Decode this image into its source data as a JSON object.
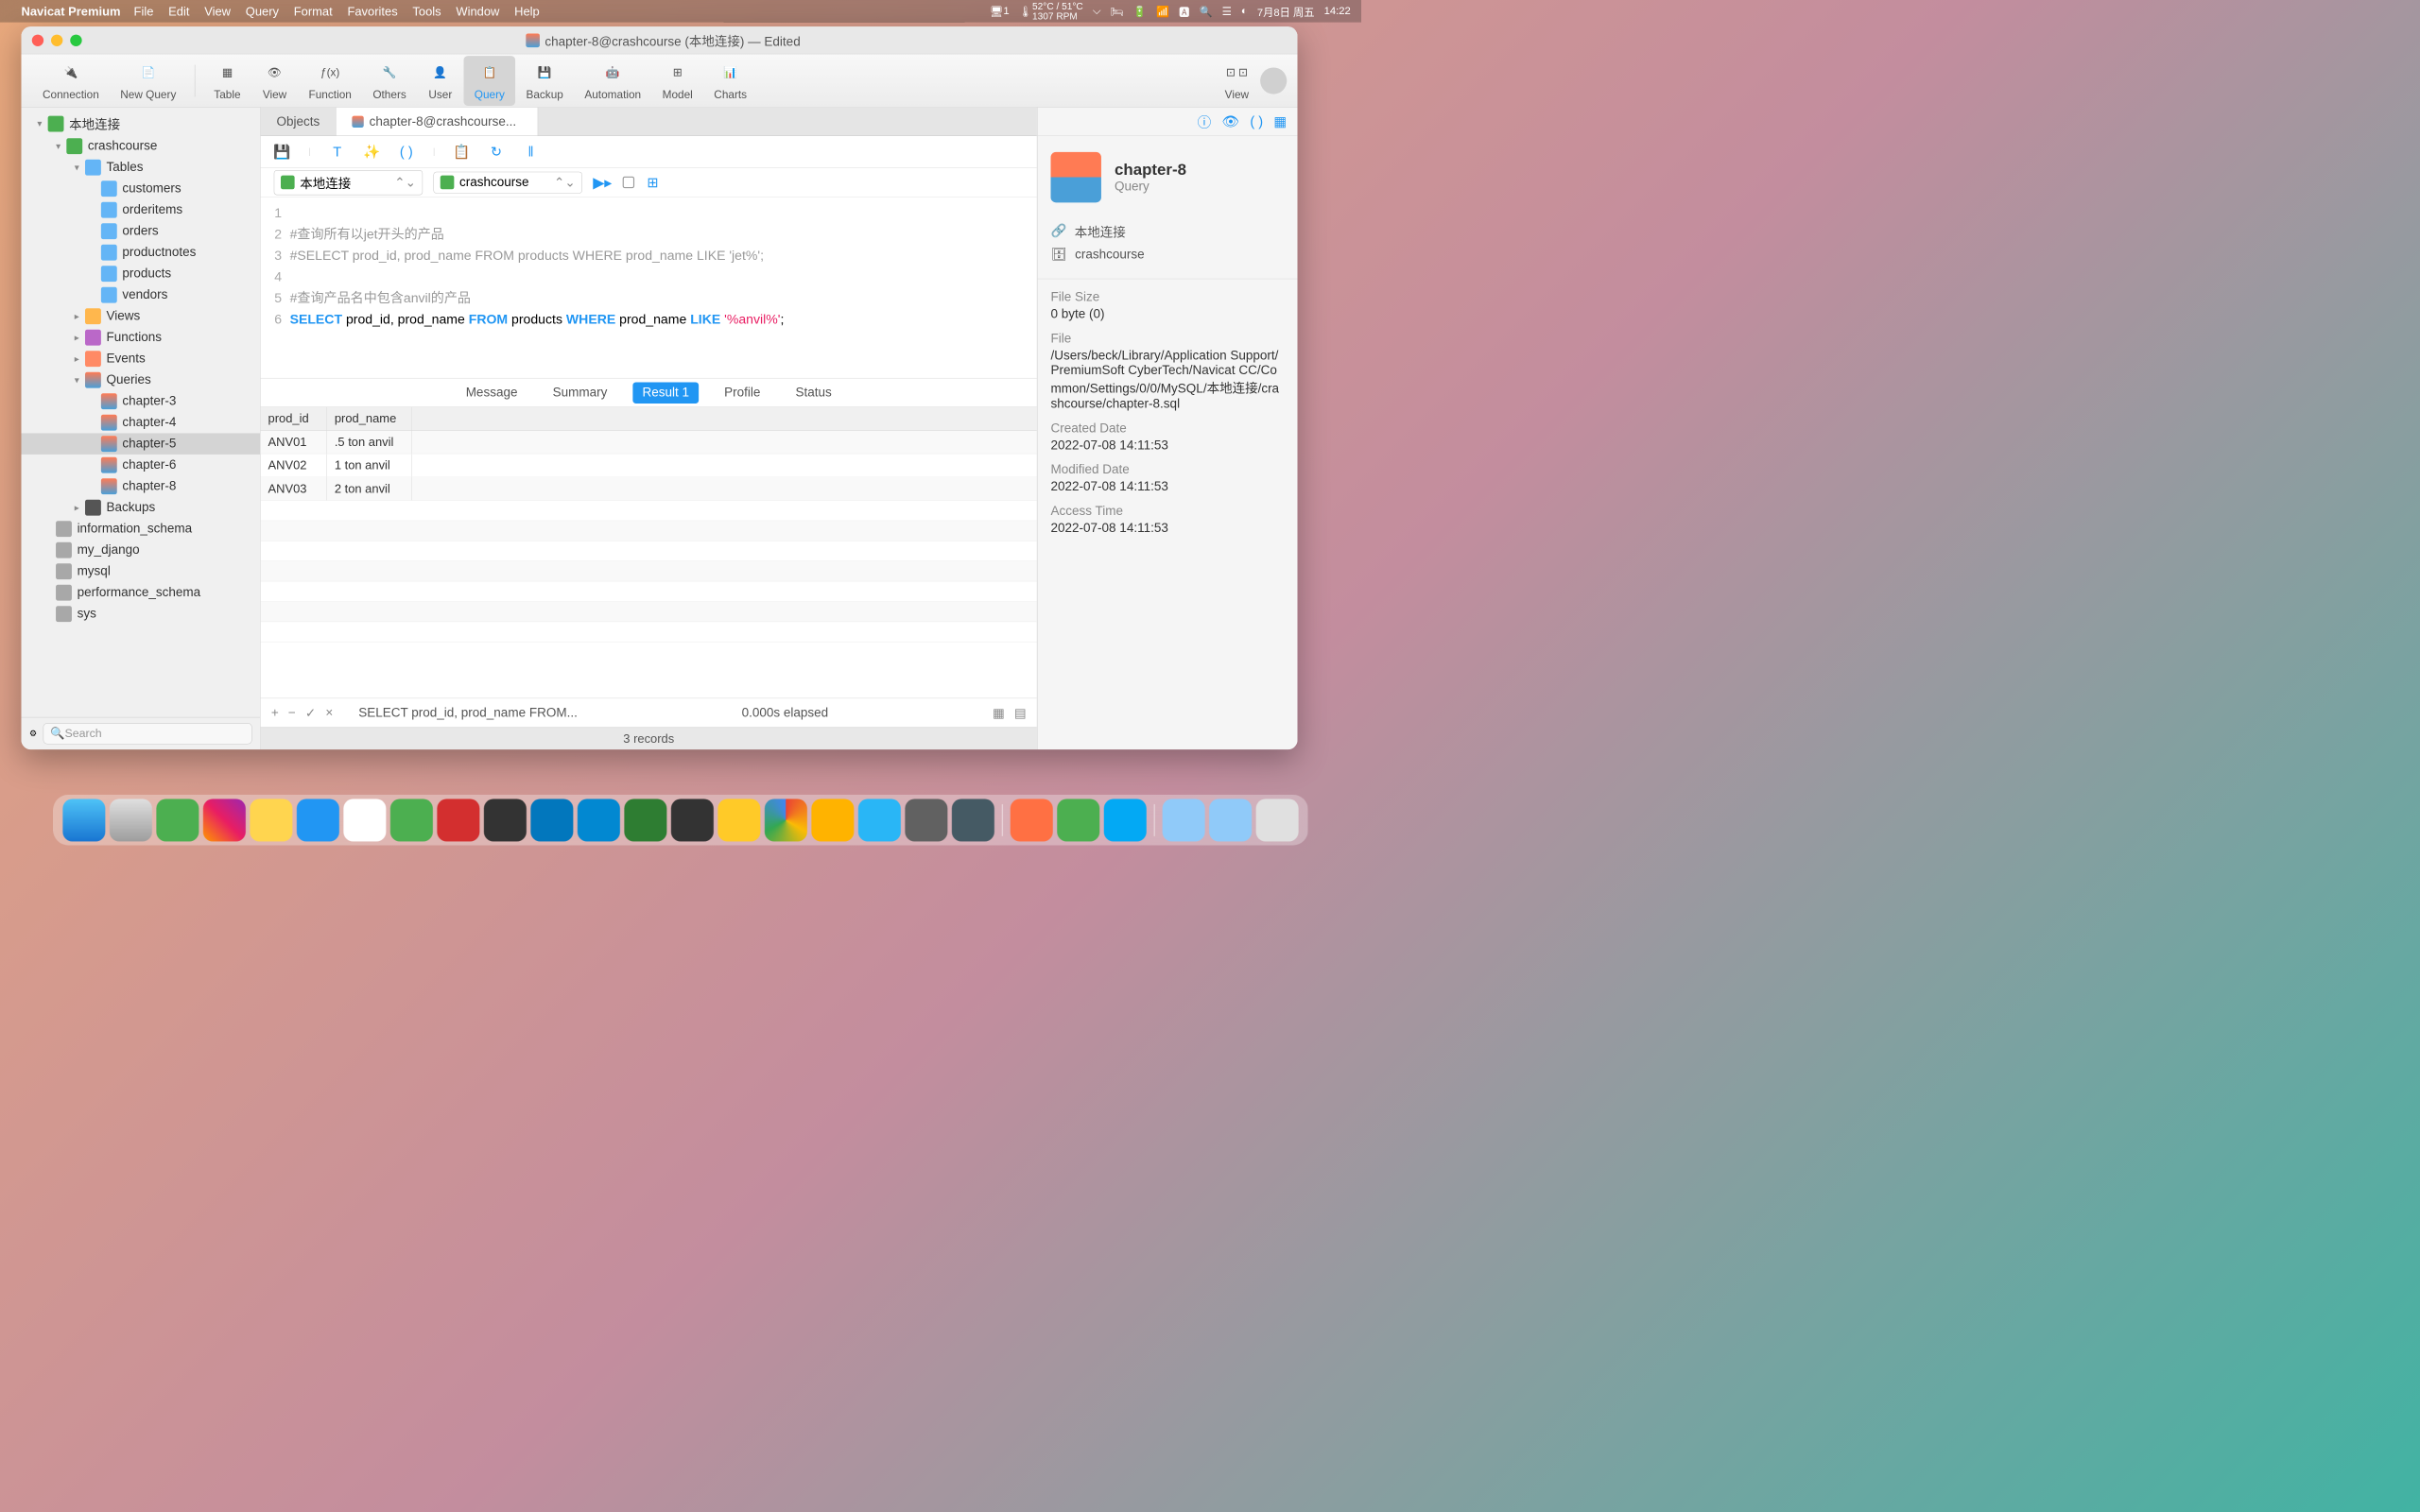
{
  "menubar": {
    "app_name": "Navicat Premium",
    "items": [
      "File",
      "Edit",
      "View",
      "Query",
      "Format",
      "Favorites",
      "Tools",
      "Window",
      "Help"
    ],
    "status": {
      "screen": "1",
      "temp_top": "52°C / 51°C",
      "temp_bot": "1307 RPM",
      "date": "7月8日 周五",
      "time": "14:22"
    }
  },
  "window": {
    "title": "chapter-8@crashcourse (本地连接) — Edited"
  },
  "toolbar": {
    "items": [
      "Connection",
      "New Query",
      "Table",
      "View",
      "Function",
      "Others",
      "User",
      "Query",
      "Backup",
      "Automation",
      "Model",
      "Charts"
    ],
    "view_label": "View"
  },
  "sidebar": {
    "conn": "本地连接",
    "db": "crashcourse",
    "tables_label": "Tables",
    "tables": [
      "customers",
      "orderitems",
      "orders",
      "productnotes",
      "products",
      "vendors"
    ],
    "views_label": "Views",
    "functions_label": "Functions",
    "events_label": "Events",
    "queries_label": "Queries",
    "queries": [
      "chapter-3",
      "chapter-4",
      "chapter-5",
      "chapter-6",
      "chapter-8"
    ],
    "backups_label": "Backups",
    "other_dbs": [
      "information_schema",
      "my_django",
      "mysql",
      "performance_schema",
      "sys"
    ],
    "search_placeholder": "Search"
  },
  "tabs": {
    "objects": "Objects",
    "active": "chapter-8@crashcourse..."
  },
  "conn_bar": {
    "connection": "本地连接",
    "database": "crashcourse"
  },
  "editor": {
    "lines": [
      {
        "n": "1",
        "text": "#查询所有以jet开头的产品",
        "type": "comment"
      },
      {
        "n": "2",
        "text": "#SELECT prod_id, prod_name FROM products WHERE prod_name LIKE 'jet%';",
        "type": "comment"
      },
      {
        "n": "3",
        "text": "",
        "type": "empty"
      },
      {
        "n": "4",
        "text": "#查询产品名中包含anvil的产品",
        "type": "comment"
      },
      {
        "n": "5",
        "text": "SELECT prod_id, prod_name FROM products WHERE prod_name LIKE '%anvil%';",
        "type": "sql"
      },
      {
        "n": "6",
        "text": "",
        "type": "empty"
      }
    ]
  },
  "result_tabs": [
    "Message",
    "Summary",
    "Result 1",
    "Profile",
    "Status"
  ],
  "result": {
    "columns": [
      "prod_id",
      "prod_name"
    ],
    "rows": [
      [
        "ANV01",
        ".5 ton anvil"
      ],
      [
        "ANV02",
        "1 ton anvil"
      ],
      [
        "ANV03",
        "2 ton anvil"
      ]
    ]
  },
  "result_footer": {
    "query": "SELECT prod_id, prod_name FROM...",
    "elapsed": "0.000s elapsed"
  },
  "status_bar": "3 records",
  "info": {
    "title": "chapter-8",
    "subtitle": "Query",
    "connection": "本地连接",
    "database": "crashcourse",
    "file_size_label": "File Size",
    "file_size": "0 byte (0)",
    "file_label": "File",
    "file_path": "/Users/beck/Library/Application Support/PremiumSoft CyberTech/Navicat CC/Common/Settings/0/0/MySQL/本地连接/crashcourse/chapter-8.sql",
    "created_label": "Created Date",
    "created": "2022-07-08 14:11:53",
    "modified_label": "Modified Date",
    "modified": "2022-07-08 14:11:53",
    "access_label": "Access Time",
    "access": "2022-07-08 14:11:53"
  }
}
